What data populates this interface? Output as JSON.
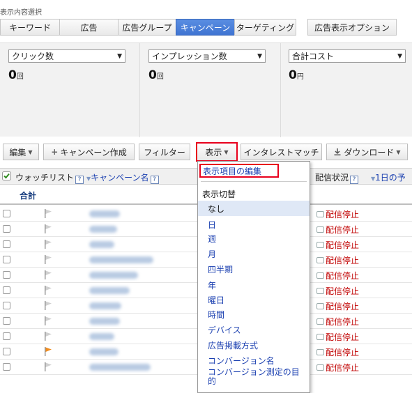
{
  "section_label": "表示内容選択",
  "view_tabs": [
    "キーワード",
    "広告",
    "広告グループ",
    "キャンペーン",
    "ターゲティング"
  ],
  "active_tab": "キャンペーン",
  "ad_display_option": "広告表示オプション",
  "metrics": [
    {
      "selector": "クリック数",
      "value": "0",
      "unit": "回"
    },
    {
      "selector": "インプレッション数",
      "value": "0",
      "unit": "回"
    },
    {
      "selector": "合計コスト",
      "value": "0",
      "unit": "円"
    }
  ],
  "toolbar": {
    "edit": "編集",
    "create_campaign": "キャンペーン作成",
    "filter": "フィルター",
    "display": "表示",
    "interest_match": "インタレストマッチ",
    "download": "ダウンロード"
  },
  "table": {
    "headers": {
      "watchlist": "ウォッチリスト",
      "campaign_name": "キャンペーン名",
      "delivery_status": "配信状況",
      "daily_budget": "1日の予"
    },
    "total_label": "合計",
    "rows": [
      {
        "status": "配信停止",
        "flag": "gray"
      },
      {
        "status": "配信停止",
        "flag": "gray"
      },
      {
        "status": "配信停止",
        "flag": "gray"
      },
      {
        "status": "配信停止",
        "flag": "gray"
      },
      {
        "status": "配信停止",
        "flag": "gray"
      },
      {
        "status": "配信停止",
        "flag": "gray"
      },
      {
        "status": "配信停止",
        "flag": "gray"
      },
      {
        "status": "配信停止",
        "flag": "gray"
      },
      {
        "status": "配信停止",
        "flag": "gray"
      },
      {
        "status": "配信停止",
        "flag": "orange"
      },
      {
        "status": "配信停止",
        "flag": "gray"
      }
    ]
  },
  "dropdown": {
    "edit_columns": "表示項目の編集",
    "switch_header": "表示切替",
    "items": [
      "なし",
      "日",
      "週",
      "月",
      "四半期",
      "年",
      "曜日",
      "時間",
      "デバイス",
      "広告掲載方式",
      "コンバージョン名",
      "コンバージョン測定の目的"
    ],
    "selected": "なし"
  },
  "colors": {
    "accent": "#3f74d2",
    "status_red": "#c00000",
    "highlight_red": "#e8001c",
    "link_blue": "#1a3fb0"
  }
}
